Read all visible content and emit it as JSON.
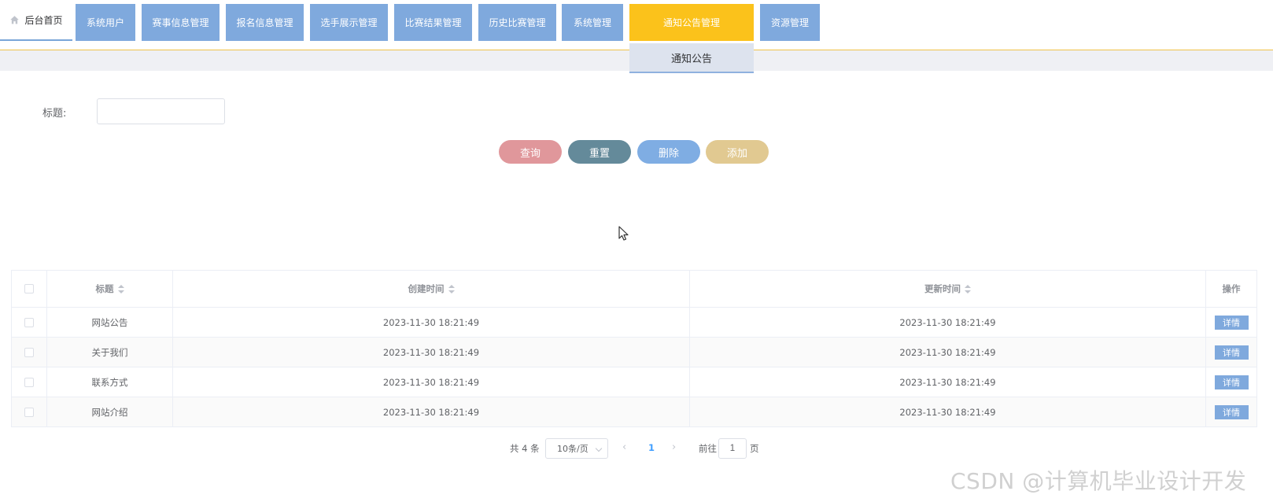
{
  "nav": {
    "home_label": "后台首页",
    "items": [
      {
        "label": "系统用户"
      },
      {
        "label": "赛事信息管理"
      },
      {
        "label": "报名信息管理"
      },
      {
        "label": "选手展示管理"
      },
      {
        "label": "比赛结果管理"
      },
      {
        "label": "历史比赛管理"
      },
      {
        "label": "系统管理"
      },
      {
        "label": "通知公告管理"
      },
      {
        "label": "资源管理"
      }
    ],
    "active_index": 7,
    "dropdown_item": "通知公告"
  },
  "search": {
    "title_label": "标题:",
    "title_value": "",
    "buttons": {
      "query": "查询",
      "reset": "重置",
      "delete": "删除",
      "add": "添加"
    }
  },
  "table": {
    "columns": {
      "title": "标题",
      "created": "创建时间",
      "updated": "更新时间",
      "ops": "操作"
    },
    "rows": [
      {
        "title": "网站公告",
        "created": "2023-11-30 18:21:49",
        "updated": "2023-11-30 18:21:49",
        "action": "详情"
      },
      {
        "title": "关于我们",
        "created": "2023-11-30 18:21:49",
        "updated": "2023-11-30 18:21:49",
        "action": "详情"
      },
      {
        "title": "联系方式",
        "created": "2023-11-30 18:21:49",
        "updated": "2023-11-30 18:21:49",
        "action": "详情"
      },
      {
        "title": "网站介绍",
        "created": "2023-11-30 18:21:49",
        "updated": "2023-11-30 18:21:49",
        "action": "详情"
      }
    ]
  },
  "pagination": {
    "total": "共 4 条",
    "page_size": "10条/页",
    "current_page": "1",
    "goto_label": "前往",
    "goto_value": "1",
    "page_suffix": "页"
  },
  "watermark": "CSDN @计算机毕业设计开发",
  "colors": {
    "nav_blue": "#7fa9dd",
    "nav_active": "#fbc21b",
    "btn_query": "#e0979b",
    "btn_reset": "#648a9a",
    "btn_delete": "#7fade3",
    "btn_add": "#e1c991"
  }
}
